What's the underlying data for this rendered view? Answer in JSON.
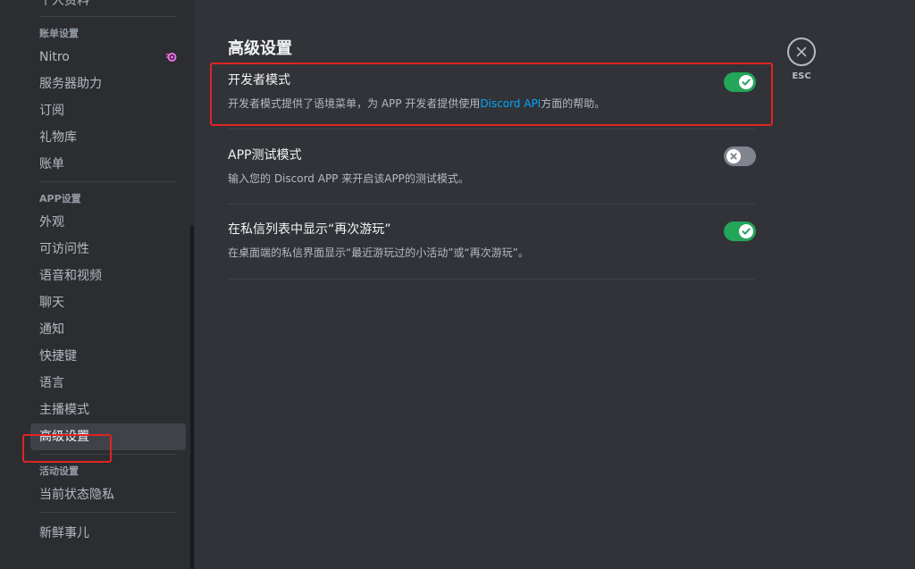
{
  "sidebar": {
    "cut_item": "个人资料",
    "billing_header": "账单设置",
    "billing_items": [
      "Nitro",
      "服务器助力",
      "订阅",
      "礼物库",
      "账单"
    ],
    "app_header": "APP设置",
    "app_items": [
      "外观",
      "可访问性",
      "语音和视频",
      "聊天",
      "通知",
      "快捷键",
      "语言",
      "主播模式",
      "高级设置"
    ],
    "activity_header": "活动设置",
    "activity_items": [
      "当前状态隐私"
    ],
    "bottom_items": [
      "新鲜事儿"
    ],
    "active_item": "高级设置"
  },
  "main": {
    "title": "高级设置",
    "close_label": "ESC",
    "settings": [
      {
        "title": "开发者模式",
        "desc_before": "开发者模式提供了语境菜单，为 APP 开发者提供使用",
        "desc_link": "Discord API",
        "desc_after": "方面的帮助。",
        "enabled": true
      },
      {
        "title": "APP测试模式",
        "desc_before": "输入您的 Discord APP 来开启该APP的测试模式。",
        "desc_link": "",
        "desc_after": "",
        "enabled": false
      },
      {
        "title": "在私信列表中显示“再次游玩”",
        "desc_before": "在桌面端的私信界面显示“最近游玩过的小活动”或“再次游玩”。",
        "desc_link": "",
        "desc_after": "",
        "enabled": true
      }
    ]
  },
  "colors": {
    "accent_green": "#23a55a",
    "link_blue": "#00a8fc",
    "highlight_red": "#e02424",
    "nitro_pink": "#ff73fa"
  }
}
